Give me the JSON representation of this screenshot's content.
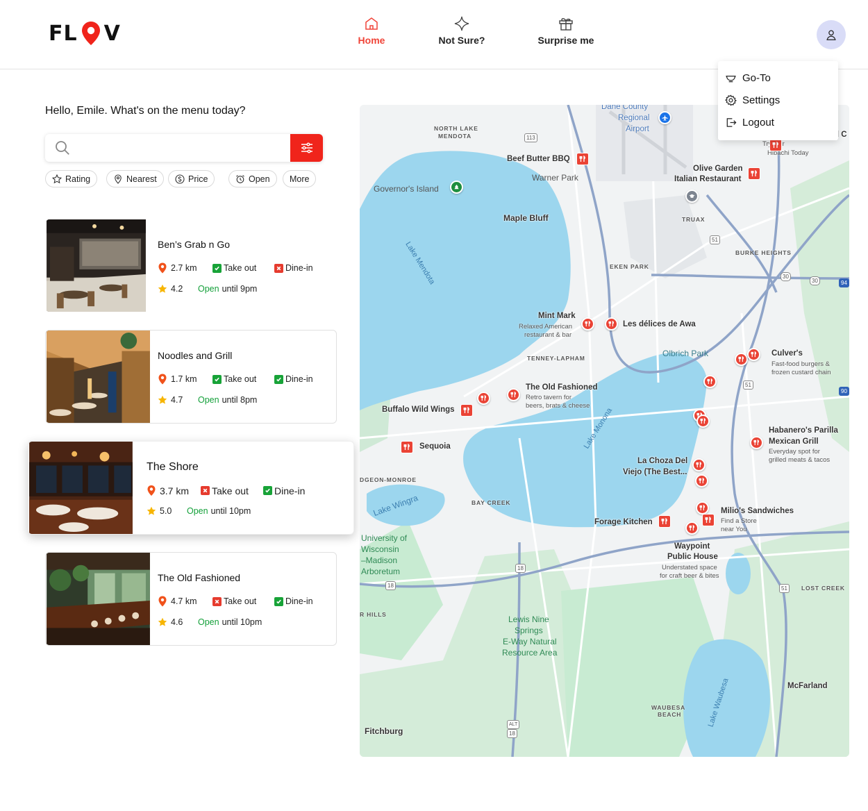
{
  "brand": {
    "logo_left": "FL",
    "logo_right": "V"
  },
  "nav": [
    {
      "label": "Home",
      "icon": "home-icon",
      "active": true
    },
    {
      "label": "Not Sure?",
      "icon": "sparkle-icon",
      "active": false
    },
    {
      "label": "Surprise me",
      "icon": "gift-icon",
      "active": false
    }
  ],
  "profile_menu": {
    "items": [
      "Go-To",
      "Settings",
      "Logout"
    ]
  },
  "greeting": "Hello, Emile. What's on the menu today?",
  "search": {
    "value": "",
    "placeholder": ""
  },
  "filters": [
    "Rating",
    "Nearest",
    "Price",
    "Open",
    "More"
  ],
  "restaurants": [
    {
      "name": "Ben’s Grab n Go",
      "distance": "2.7 km",
      "takeout_label": "Take out",
      "takeout": true,
      "dinein_label": "Dine-in",
      "dinein": false,
      "rating": "4.2",
      "open_label": "Open",
      "hours": "until 9pm"
    },
    {
      "name": "Noodles and Grill",
      "distance": "1.7 km",
      "takeout_label": "Take out",
      "takeout": true,
      "dinein_label": "Dine-in",
      "dinein": true,
      "rating": "4.7",
      "open_label": "Open",
      "hours": "until 8pm"
    },
    {
      "name": "The Shore",
      "distance": "3.7 km",
      "takeout_label": "Take out",
      "takeout": false,
      "dinein_label": "Dine-in",
      "dinein": true,
      "rating": "5.0",
      "open_label": "Open",
      "hours": "until 10pm"
    },
    {
      "name": "The Old Fashioned",
      "distance": "4.7 km",
      "takeout_label": "Take out",
      "takeout": false,
      "dinein_label": "Dine-in",
      "dinein": true,
      "rating": "4.6",
      "open_label": "Open",
      "hours": "until 10pm"
    }
  ],
  "map": {
    "places": {
      "dane_county_1": "Dane County",
      "dane_county_2": "Regional",
      "dane_county_3": "Airport",
      "north_lake_1": "NORTH LAKE",
      "north_lake_2": "MENDOTA",
      "beef_butter": "Beef Butter BBQ",
      "warner_park": "Warner Park",
      "governors_island": "Governor's Island",
      "maple_bluff": "Maple Bluff",
      "lake_mendota": "Lake Mendota",
      "olive_garden_1": "Olive Garden",
      "olive_garden_2": "Italian Restaurant",
      "truax": "TRUAX",
      "burke_heights": "BURKE HEIGHTS",
      "eken_park": "EKEN PARK",
      "mint_mark": "Mint Mark",
      "mint_mark_sub_1": "Relaxed American",
      "mint_mark_sub_2": "restaurant & bar",
      "les_delices": "Les délices de Awa",
      "tenney": "TENNEY-LAPHAM",
      "olbrich": "Olbrich Park",
      "culvers": "Culver's",
      "culvers_sub_1": "Fast-food burgers &",
      "culvers_sub_2": "frozen custard chain",
      "old_fashioned": "The Old Fashioned",
      "old_fashioned_sub_1": "Retro tavern for",
      "old_fashioned_sub_2": "beers, brats & cheese",
      "buffalo": "Buffalo Wild Wings",
      "sequoia": "Sequoia",
      "lake_monona": "Lake Monona",
      "habaneros_1": "Habanero's Parilla",
      "habaneros_2": "Mexican Grill",
      "habaneros_sub_1": "Everyday spot for",
      "habaneros_sub_2": "grilled meats & tacos",
      "la_choza_1": "La Choza Del",
      "la_choza_2": "Viejo (The Best...",
      "dgeon": "DGEON-MONROE",
      "bay_creek": "BAY CREEK",
      "lake_wingra": "Lake Wingra",
      "forage": "Forage Kitchen",
      "milios": "Milio's Sandwiches",
      "milios_sub_1": "Find a Store",
      "milios_sub_2": "near You",
      "uw_1": "University of",
      "uw_2": "Wisconsin",
      "uw_3": "–Madison",
      "uw_4": "Arboretum",
      "waypoint_1": "Waypoint",
      "waypoint_2": "Public House",
      "waypoint_sub_1": "Understated space",
      "waypoint_sub_2": "for craft beer & bites",
      "lost_creek": "LOST CREEK",
      "r_hills": "R HILLS",
      "lewis_1": "Lewis Nine",
      "lewis_2": "Springs",
      "lewis_3": "E-Way Natural",
      "lewis_4": "Resource Area",
      "mcfarland": "McFarland",
      "waubesa_beach_1": "WAUBESA",
      "waubesa_beach_2": "BEACH",
      "lake_waubesa": "Lake Waubesa",
      "fitchburg": "Fitchburg",
      "try_our_1": "Try Our",
      "try_our_2": "Hibachi Today",
      "nd_c": "nd C"
    },
    "route_shields": [
      "113",
      "51",
      "30",
      "30",
      "94",
      "51",
      "90",
      "18",
      "18",
      "51",
      "18",
      "ALT"
    ],
    "colors": {
      "water": "#9cd6ee",
      "park": "#c8ebd2",
      "land": "#f1f3f4",
      "road": "#ffffff",
      "highway": "#8fa4c8",
      "pin": "#ea4335"
    }
  },
  "colors": {
    "accent": "#f04438",
    "open": "#14a03a",
    "avatar_bg": "#d9dcf7"
  }
}
